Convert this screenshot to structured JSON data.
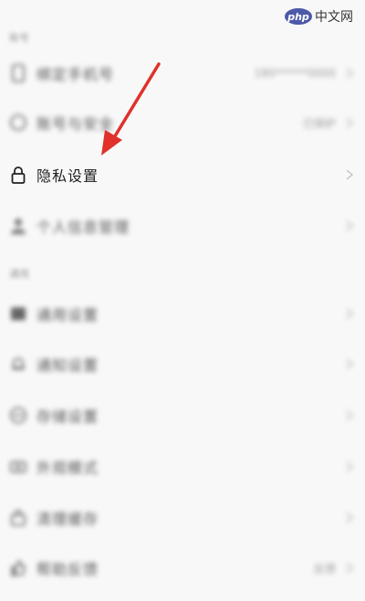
{
  "watermark": {
    "badge": "php",
    "text": "中文网"
  },
  "settings": {
    "sections": [
      {
        "label": "账号"
      },
      {
        "label": "通用"
      }
    ],
    "rows": [
      {
        "label": "绑定手机号",
        "value": "180******0000",
        "icon": "phone-icon"
      },
      {
        "label": "账号与安全",
        "value": "已保护",
        "icon": "shield-icon"
      },
      {
        "label": "隐私设置",
        "value": "",
        "icon": "lock-icon"
      },
      {
        "label": "个人信息管理",
        "value": "",
        "icon": "person-icon"
      },
      {
        "label": "通用设置",
        "value": "",
        "icon": "grid-icon"
      },
      {
        "label": "通知设置",
        "value": "",
        "icon": "bell-icon"
      },
      {
        "label": "存储设置",
        "value": "",
        "icon": "storage-icon"
      },
      {
        "label": "外观模式",
        "value": "",
        "icon": "camera-icon"
      },
      {
        "label": "清理缓存",
        "value": "",
        "icon": "bag-icon"
      },
      {
        "label": "帮助反馈",
        "value": "反馈",
        "icon": "thumb-icon"
      }
    ]
  },
  "annotation": {
    "arrow_color": "#e0312b"
  }
}
